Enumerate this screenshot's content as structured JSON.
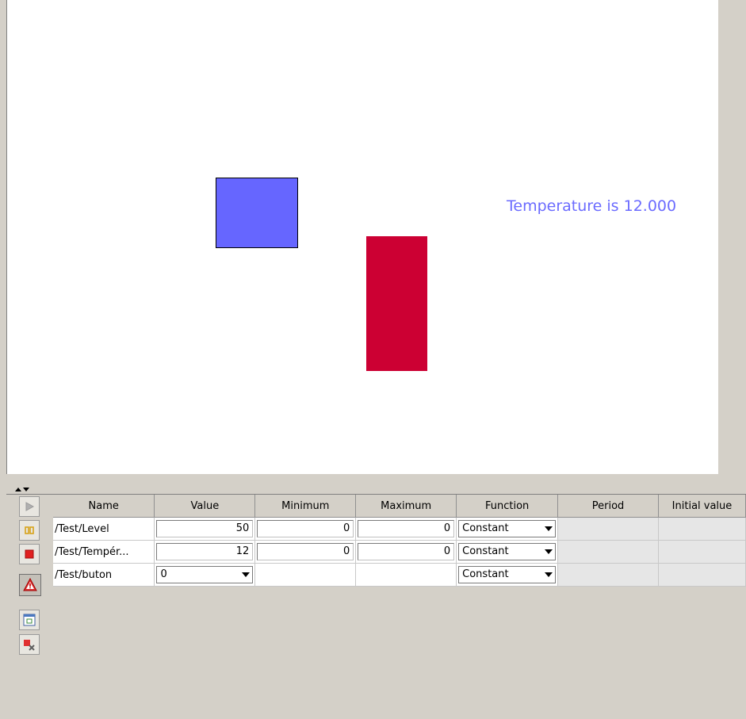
{
  "colors": {
    "blue_shape": "#6666ff",
    "red_shape": "#cc0033",
    "temperature_text": "#6b6bff"
  },
  "canvas": {
    "temperature_label": "Temperature is 12.000"
  },
  "toolbar": {
    "buttons": [
      {
        "name": "play-icon"
      },
      {
        "name": "pause-icon"
      },
      {
        "name": "stop-icon"
      },
      {
        "name": "warning-icon"
      },
      {
        "name": "fit-view-icon"
      },
      {
        "name": "remove-icon"
      }
    ]
  },
  "table": {
    "columns": [
      "Name",
      "Value",
      "Minimum",
      "Maximum",
      "Function",
      "Period",
      "Initial value"
    ],
    "rows": [
      {
        "name": "/Test/Level",
        "value": "50",
        "minimum": "0",
        "maximum": "0",
        "function": "Constant",
        "period": "",
        "initial": ""
      },
      {
        "name": "/Test/Tempér...",
        "value": "12",
        "minimum": "0",
        "maximum": "0",
        "function": "Constant",
        "period": "",
        "initial": ""
      },
      {
        "name": "/Test/buton",
        "value": "0",
        "minimum": "",
        "maximum": "",
        "function": "Constant",
        "period": "",
        "initial": ""
      }
    ]
  }
}
